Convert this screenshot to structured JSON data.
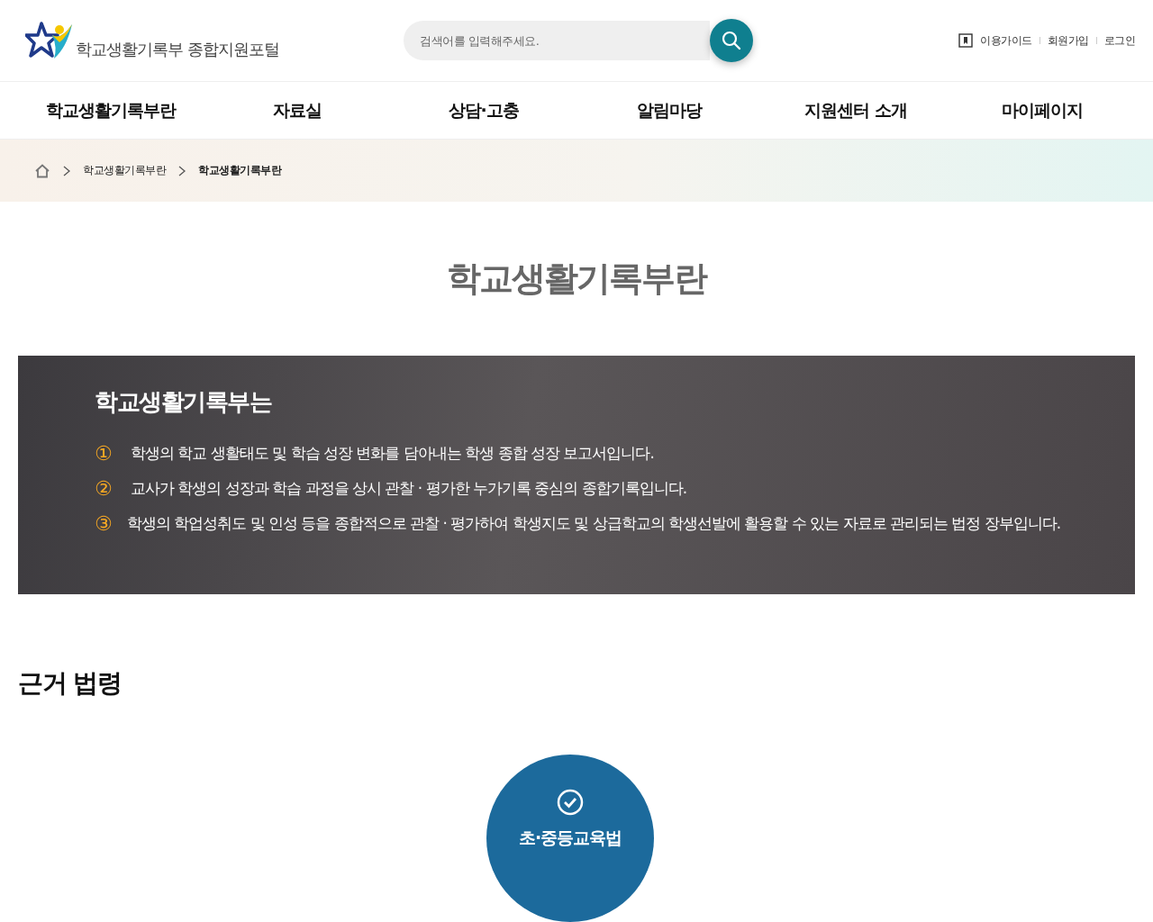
{
  "header": {
    "logo_text": "학교생활기록부 종합지원포털",
    "search": {
      "placeholder": "검색어를 입력해주세요."
    },
    "util_links": [
      {
        "label": "이용가이드",
        "kind": "guide"
      },
      {
        "label": "회원가입",
        "kind": "plain"
      },
      {
        "label": "로그인",
        "kind": "plain"
      }
    ]
  },
  "nav": {
    "items": [
      "학교생활기록부란",
      "자료실",
      "상담·고충",
      "알림마당",
      "지원센터 소개",
      "마이페이지"
    ]
  },
  "breadcrumb": [
    {
      "label": "학교생활기록부란",
      "selected": false
    },
    {
      "label": "학교생활기록부란",
      "selected": true
    }
  ],
  "page_title": "학교생활기록부란",
  "banner": {
    "title": "학교생활기록부는",
    "items": [
      {
        "marker": "①",
        "text": "학생의 학교 생활태도 및 학습 성장 변화를 담아내는 학생 종합 성장 보고서입니다."
      },
      {
        "marker": "②",
        "text": "교사가 학생의 성장과 학습 과정을 상시 관찰 · 평가한 누가기록 중심의 종합기록입니다."
      },
      {
        "marker": "③",
        "text": "학생의 학업성취도 및 인성 등을 종합적으로 관찰 · 평가하여 학생지도 및 상급학교의 학생선발에 활용할 수 있는 자료로 관리되는 법정 장부입니다."
      }
    ]
  },
  "laws": {
    "heading": "근거 법령",
    "items": [
      {
        "label": "초·중등교육법"
      }
    ]
  }
}
